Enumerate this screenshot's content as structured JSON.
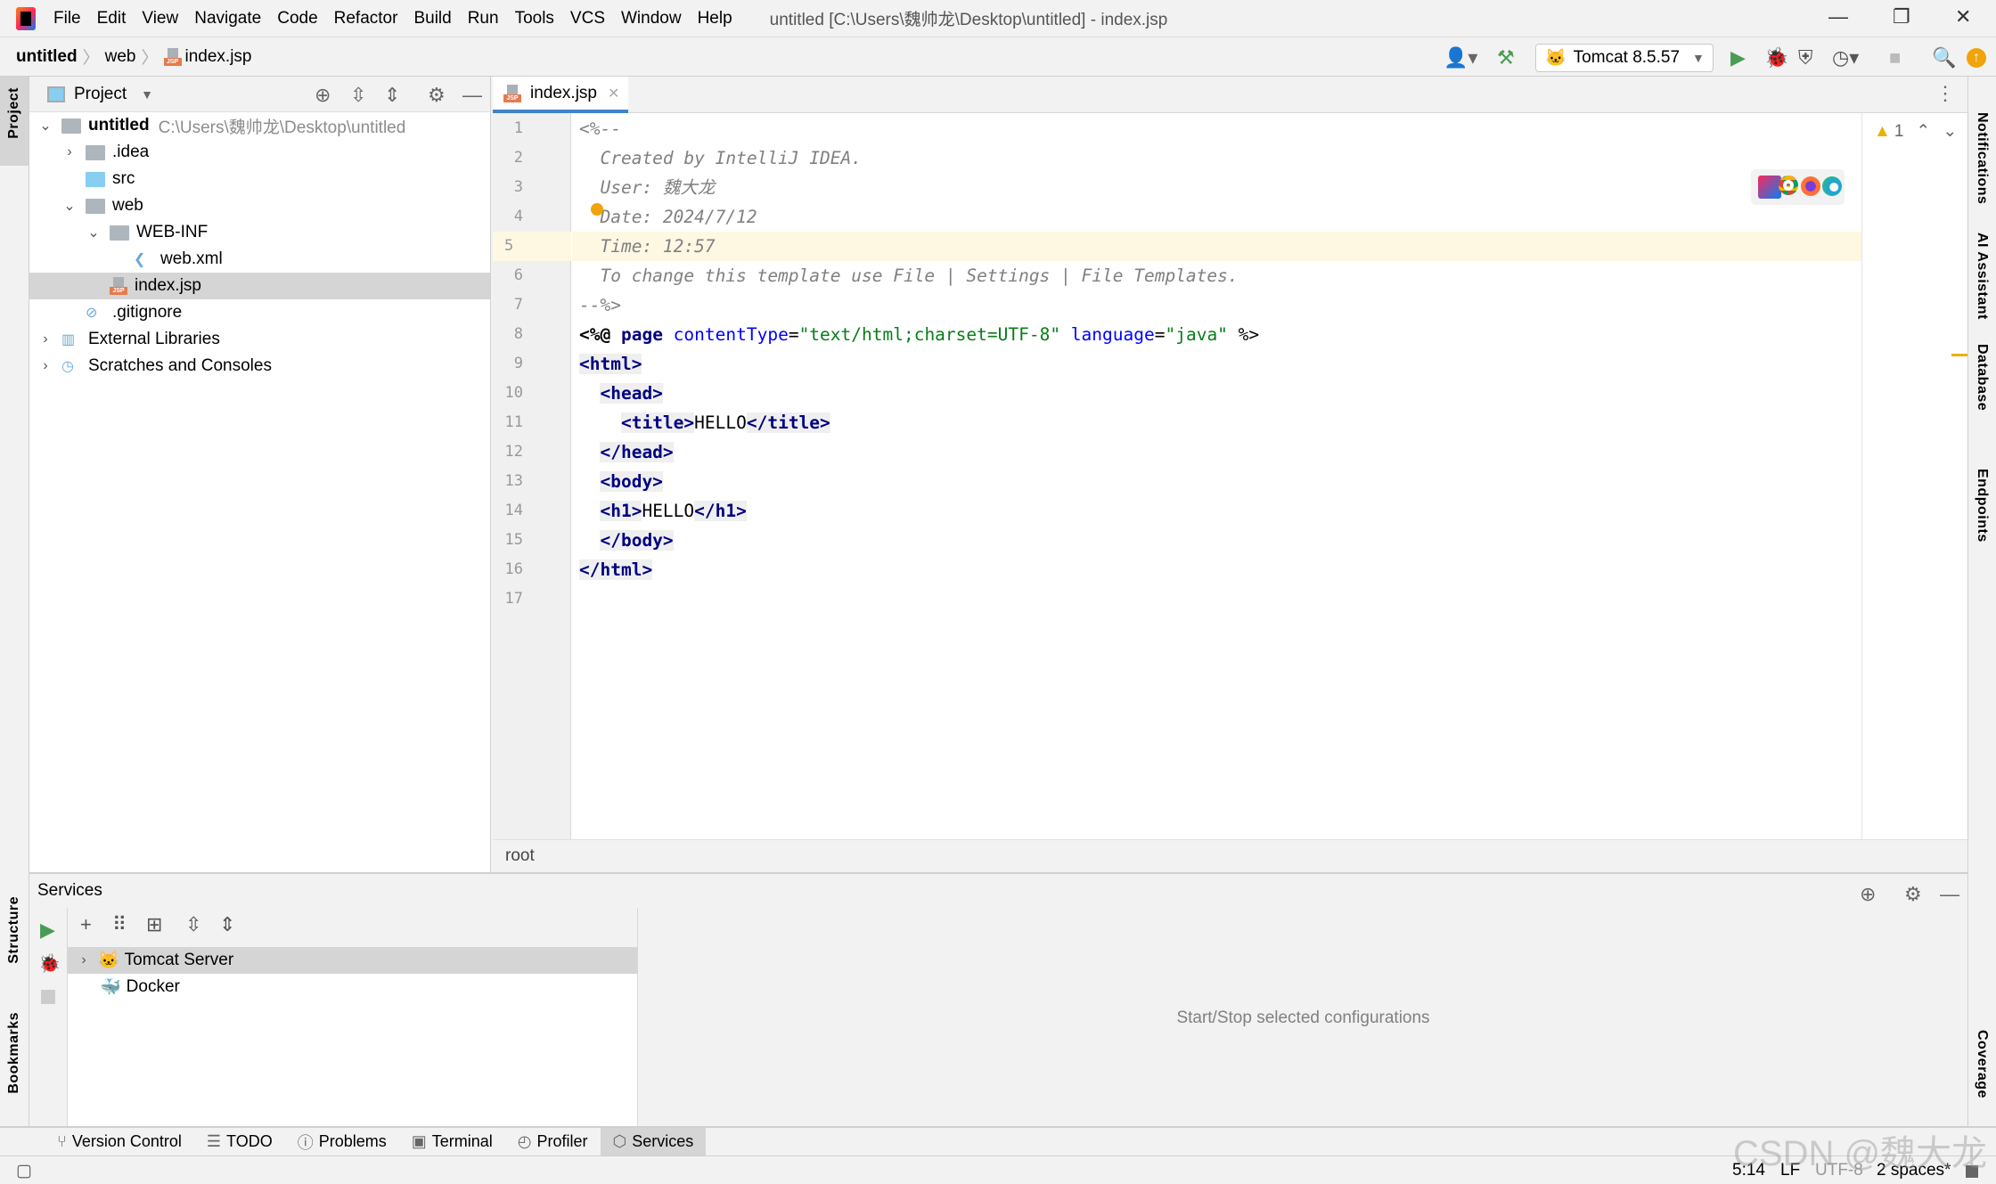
{
  "menubar": {
    "items": [
      "File",
      "Edit",
      "View",
      "Navigate",
      "Code",
      "Refactor",
      "Build",
      "Run",
      "Tools",
      "VCS",
      "Window",
      "Help"
    ],
    "title": "untitled [C:\\Users\\魏帅龙\\Desktop\\untitled] - index.jsp"
  },
  "navbar": {
    "crumbs": [
      "untitled",
      "web",
      "index.jsp"
    ],
    "run_config": "Tomcat 8.5.57"
  },
  "left_stripe": {
    "top": "Project",
    "structure": "Structure",
    "bookmarks": "Bookmarks"
  },
  "right_stripe": [
    "Notifications",
    "AI Assistant",
    "Database",
    "Endpoints",
    "Coverage"
  ],
  "project": {
    "title": "Project",
    "tree": [
      {
        "label": "untitled",
        "path": "C:\\Users\\魏帅龙\\Desktop\\untitled",
        "level": 0,
        "chev": "down",
        "icon": "module-folder-icon",
        "bold": true
      },
      {
        "label": ".idea",
        "level": 1,
        "chev": "right",
        "icon": "folder-icon"
      },
      {
        "label": "src",
        "level": 1,
        "chev": "",
        "icon": "source-folder-icon"
      },
      {
        "label": "web",
        "level": 1,
        "chev": "down",
        "icon": "web-folder-icon"
      },
      {
        "label": "WEB-INF",
        "level": 2,
        "chev": "down",
        "icon": "folder-icon"
      },
      {
        "label": "web.xml",
        "level": 3,
        "chev": "",
        "icon": "xml-file-icon"
      },
      {
        "label": "index.jsp",
        "level": 2,
        "chev": "",
        "icon": "jsp-file-icon",
        "selected": true
      },
      {
        "label": ".gitignore",
        "level": 1,
        "chev": "",
        "icon": "gitignore-file-icon"
      },
      {
        "label": "External Libraries",
        "level": 0,
        "chev": "right",
        "icon": "libraries-icon"
      },
      {
        "label": "Scratches and Consoles",
        "level": 0,
        "chev": "right",
        "icon": "scratches-icon"
      }
    ]
  },
  "editor": {
    "tab": "index.jsp",
    "warnings": "1",
    "breadcrumb": "root",
    "current_line": 5,
    "lines": [
      [
        [
          "cm",
          "<%--"
        ]
      ],
      [
        [
          "cm",
          "  Created by IntelliJ IDEA."
        ]
      ],
      [
        [
          "cm",
          "  User: 魏大龙"
        ]
      ],
      [
        [
          "cm",
          "  Date: 2024/7/12"
        ]
      ],
      [
        [
          "cm",
          "  Time: 12:57"
        ]
      ],
      [
        [
          "cm",
          "  To change this template use File | Settings | File Templates."
        ]
      ],
      [
        [
          "cm",
          "--%>"
        ]
      ],
      [
        [
          "dir",
          "<%@ "
        ],
        [
          "tag",
          "page "
        ],
        [
          "kw",
          "contentType"
        ],
        [
          "",
          "="
        ],
        [
          "str",
          "\"text/html;charset=UTF-8\""
        ],
        [
          "kw",
          " language"
        ],
        [
          "",
          "="
        ],
        [
          "str",
          "\"java\""
        ],
        [
          "",
          " %>"
        ]
      ],
      [
        [
          "tag hl",
          "<html>"
        ]
      ],
      [
        [
          "",
          "  "
        ],
        [
          "tag hl",
          "<head>"
        ]
      ],
      [
        [
          "",
          "    "
        ],
        [
          "tag hl",
          "<title>"
        ],
        [
          "",
          "HELLO"
        ],
        [
          "tag hl",
          "</title>"
        ]
      ],
      [
        [
          "",
          "  "
        ],
        [
          "tag hl",
          "</head>"
        ]
      ],
      [
        [
          "",
          "  "
        ],
        [
          "tag hl",
          "<body>"
        ]
      ],
      [
        [
          "",
          "  "
        ],
        [
          "tag hl",
          "<h1>"
        ],
        [
          "",
          "HELLO"
        ],
        [
          "tag hl",
          "</h1>"
        ]
      ],
      [
        [
          "",
          "  "
        ],
        [
          "tag hl",
          "</body>"
        ]
      ],
      [
        [
          "tag hl",
          "</html>"
        ]
      ],
      []
    ]
  },
  "services": {
    "title": "Services",
    "items": [
      "Tomcat Server",
      "Docker"
    ],
    "hint": "Start/Stop selected configurations"
  },
  "bottom_tabs": [
    "Version Control",
    "TODO",
    "Problems",
    "Terminal",
    "Profiler",
    "Services"
  ],
  "status": {
    "position": "5:14",
    "line_sep": "LF",
    "encoding": "UTF-8",
    "indent": "2 spaces*"
  },
  "watermark": "CSDN @魏大龙",
  "colors": {
    "accent": "#4083c9",
    "run_green": "#499c54",
    "warning": "#e8b200",
    "update": "#f0a30a"
  }
}
